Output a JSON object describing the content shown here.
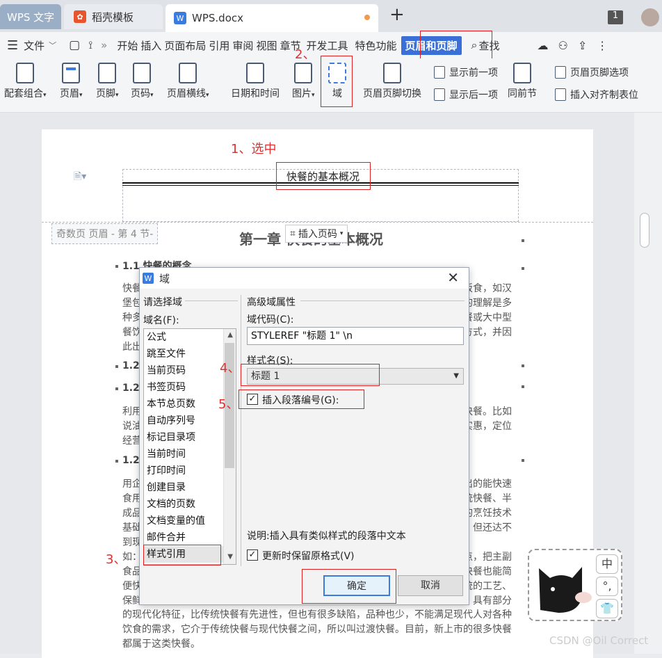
{
  "tabs": [
    {
      "label": "WPS 文字"
    },
    {
      "label": "稻壳模板"
    },
    {
      "label": "WPS.docx"
    }
  ],
  "window": {
    "count_badge": "1"
  },
  "menu": {
    "file": "文件",
    "items": [
      "开始",
      "插入",
      "页面布局",
      "引用",
      "审阅",
      "视图",
      "章节",
      "开发工具",
      "特色功能"
    ],
    "active": "页眉和页脚",
    "search": "查找"
  },
  "ribbon": {
    "buttons": [
      "配套组合",
      "页眉",
      "页脚",
      "页码",
      "页眉横线",
      "日期和时间",
      "图片",
      "域",
      "页眉页脚切换",
      "同前节"
    ],
    "show_prev": "显示前一项",
    "show_next": "显示后一项",
    "hf_options": "页眉页脚选项",
    "insert_align_tab": "插入对齐制表位"
  },
  "annotations": {
    "a1": "1、选中",
    "a2": "2、",
    "a3": "3、",
    "a4": "4、",
    "a5": "5、"
  },
  "document": {
    "header_text": "快餐的基本概况",
    "odd_page_label": "奇数页 页眉 - 第 4 节-",
    "insert_page_number": "插入页码",
    "chapter_title": "第一章 快餐的基本概况",
    "sec_1_1": "1.1 快餐的概念",
    "sec_1_2": "1.2",
    "sec_1_2_1": "1.2.",
    "sec_1_2_2": "1.2.",
    "lines_left": [
      "快餐",
      "堡包",
      "种多",
      "餐饮",
      "此出"
    ],
    "lines_right": [
      "饭食，如汉",
      "的理解是多",
      "餐或大中型",
      "方式，并因"
    ],
    "lines2_left": [
      "利用",
      "说油",
      "经营"
    ],
    "lines2_right": [
      "快餐。比如",
      "实惠，定位"
    ],
    "lines3_left": [
      "用企",
      "食用",
      "成品",
      "基础",
      "到现",
      "如：",
      "食品",
      "便快",
      "保鲜"
    ],
    "lines3_right": [
      "出的能快速",
      "统快餐、半",
      "的烹饪技术",
      "，但还达不",
      "点，把主副",
      "快餐也能简",
      "统的工艺、",
      "，具有部分"
    ],
    "bottom_lines": [
      "的现代化特征，比传统快餐有先进性，但也有很多缺陷，品种也少，不能满足现代人对各种",
      "饮食的需求，它介于传统快餐与现代快餐之间，所以叫过渡快餐。目前，新上市的很多快餐",
      "都属于这类快餐。"
    ]
  },
  "dialog": {
    "title": "域",
    "left_group": "请选择域",
    "field_name_label": "域名(F):",
    "field_list": [
      "公式",
      "跳至文件",
      "当前页码",
      "书签页码",
      "本节总页数",
      "自动序列号",
      "标记目录项",
      "当前时间",
      "打印时间",
      "创建目录",
      "文档的页数",
      "文档变量的值",
      "邮件合并",
      "样式引用"
    ],
    "selected_field": "样式引用",
    "right_group": "高级域属性",
    "field_code_label": "域代码(C):",
    "field_code_value": "STYLEREF \"标题 1\" \\n",
    "style_name_label": "样式名(S):",
    "style_name_value": "标题 1",
    "insert_para_number": "插入段落编号(G):",
    "description": "说明:插入具有类似样式的段落中文本",
    "preserve_format": "更新时保留原格式(V)",
    "ok": "确定",
    "cancel": "取消"
  },
  "ime": {
    "b1": "中",
    "b2": "°,"
  },
  "watermark": "CSDN @Oil Correct"
}
